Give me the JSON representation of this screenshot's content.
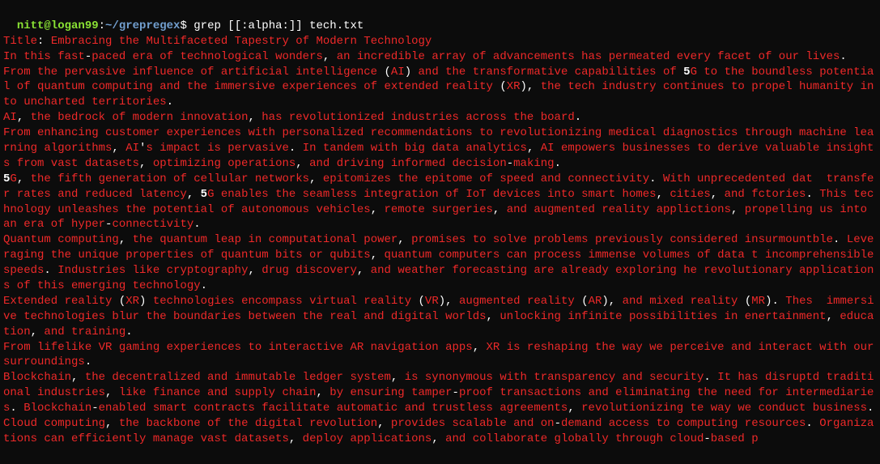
{
  "prompt": {
    "user": "nitt",
    "at": "@",
    "host": "logan99",
    "colon": ":",
    "path": "~/grepregex",
    "dollar": "$ ",
    "command": "grep [[:alpha:]] tech.txt"
  },
  "lines": [
    {
      "parts": [
        {
          "t": "Title",
          "c": "red"
        },
        {
          "t": ": ",
          "c": "white"
        },
        {
          "t": "Embracing the Multifaceted Tapestry of Modern Technology",
          "c": "red"
        }
      ]
    },
    {
      "parts": [
        {
          "t": "In this fast",
          "c": "red"
        },
        {
          "t": "-",
          "c": "white"
        },
        {
          "t": "paced era of technological wonders",
          "c": "red"
        },
        {
          "t": ", ",
          "c": "white"
        },
        {
          "t": "an incredible array of advancements has permeated every facet of our lives",
          "c": "red"
        },
        {
          "t": ".",
          "c": "white"
        }
      ]
    },
    {
      "parts": [
        {
          "t": "From the pervasive influence of artificial intelligence ",
          "c": "red"
        },
        {
          "t": "(",
          "c": "white"
        },
        {
          "t": "AI",
          "c": "red"
        },
        {
          "t": ") ",
          "c": "white"
        },
        {
          "t": "and the transformative capabilities of ",
          "c": "red"
        },
        {
          "t": "5",
          "c": "bold"
        },
        {
          "t": "G to the boundless potential of quantum computing and the immersive experiences of extended reality ",
          "c": "red"
        },
        {
          "t": "(",
          "c": "white"
        },
        {
          "t": "XR",
          "c": "red"
        },
        {
          "t": "), ",
          "c": "white"
        },
        {
          "t": "the tech industry continues to propel humanity into uncharted territories",
          "c": "red"
        },
        {
          "t": ".",
          "c": "white"
        }
      ]
    },
    {
      "parts": [
        {
          "t": "AI",
          "c": "red"
        },
        {
          "t": ", ",
          "c": "white"
        },
        {
          "t": "the bedrock of modern innovation",
          "c": "red"
        },
        {
          "t": ", ",
          "c": "white"
        },
        {
          "t": "has revolutionized industries across the board",
          "c": "red"
        },
        {
          "t": ".",
          "c": "white"
        }
      ]
    },
    {
      "parts": [
        {
          "t": "From enhancing customer experiences with personalized recommendations to revolutionizing medical diagnostics through machine learning algorithms",
          "c": "red"
        },
        {
          "t": ", ",
          "c": "white"
        },
        {
          "t": "AI",
          "c": "red"
        },
        {
          "t": "'",
          "c": "white"
        },
        {
          "t": "s impact is pervasive",
          "c": "red"
        },
        {
          "t": ". ",
          "c": "white"
        },
        {
          "t": "In tandem with big data analytics",
          "c": "red"
        },
        {
          "t": ", ",
          "c": "white"
        },
        {
          "t": "AI empowers businesses to derive valuable insights from vast datasets",
          "c": "red"
        },
        {
          "t": ", ",
          "c": "white"
        },
        {
          "t": "optimizing operations",
          "c": "red"
        },
        {
          "t": ", ",
          "c": "white"
        },
        {
          "t": "and driving informed decision",
          "c": "red"
        },
        {
          "t": "-",
          "c": "white"
        },
        {
          "t": "making",
          "c": "red"
        },
        {
          "t": ".",
          "c": "white"
        }
      ]
    },
    {
      "parts": [
        {
          "t": "5",
          "c": "bold"
        },
        {
          "t": "G",
          "c": "red"
        },
        {
          "t": ", ",
          "c": "white"
        },
        {
          "t": "the fifth generation of cellular networks",
          "c": "red"
        },
        {
          "t": ", ",
          "c": "white"
        },
        {
          "t": "epitomizes the epitome of speed and connectivity",
          "c": "red"
        },
        {
          "t": ". ",
          "c": "white"
        },
        {
          "t": "With unprecedented dat  transfer rates and reduced latency",
          "c": "red"
        },
        {
          "t": ", ",
          "c": "white"
        },
        {
          "t": "5",
          "c": "bold"
        },
        {
          "t": "G enables the seamless integration of IoT devices into smart homes",
          "c": "red"
        },
        {
          "t": ", ",
          "c": "white"
        },
        {
          "t": "cities",
          "c": "red"
        },
        {
          "t": ", ",
          "c": "white"
        },
        {
          "t": "and fctories",
          "c": "red"
        },
        {
          "t": ". ",
          "c": "white"
        },
        {
          "t": "This technology unleashes the potential of autonomous vehicles",
          "c": "red"
        },
        {
          "t": ", ",
          "c": "white"
        },
        {
          "t": "remote surgeries",
          "c": "red"
        },
        {
          "t": ", ",
          "c": "white"
        },
        {
          "t": "and augmented reality applictions",
          "c": "red"
        },
        {
          "t": ", ",
          "c": "white"
        },
        {
          "t": "propelling us into an era of hyper",
          "c": "red"
        },
        {
          "t": "-",
          "c": "white"
        },
        {
          "t": "connectivity",
          "c": "red"
        },
        {
          "t": ".",
          "c": "white"
        }
      ]
    },
    {
      "parts": [
        {
          "t": "Quantum computing",
          "c": "red"
        },
        {
          "t": ", ",
          "c": "white"
        },
        {
          "t": "the quantum leap in computational power",
          "c": "red"
        },
        {
          "t": ", ",
          "c": "white"
        },
        {
          "t": "promises to solve problems previously considered insurmountble",
          "c": "red"
        },
        {
          "t": ". ",
          "c": "white"
        },
        {
          "t": "Leveraging the unique properties of quantum bits or qubits",
          "c": "red"
        },
        {
          "t": ", ",
          "c": "white"
        },
        {
          "t": "quantum computers can process immense volumes of data t incomprehensible speeds",
          "c": "red"
        },
        {
          "t": ". ",
          "c": "white"
        },
        {
          "t": "Industries like cryptography",
          "c": "red"
        },
        {
          "t": ", ",
          "c": "white"
        },
        {
          "t": "drug discovery",
          "c": "red"
        },
        {
          "t": ", ",
          "c": "white"
        },
        {
          "t": "and weather forecasting are already exploring he revolutionary applications of this emerging technology",
          "c": "red"
        },
        {
          "t": ".",
          "c": "white"
        }
      ]
    },
    {
      "parts": [
        {
          "t": "Extended reality ",
          "c": "red"
        },
        {
          "t": "(",
          "c": "white"
        },
        {
          "t": "XR",
          "c": "red"
        },
        {
          "t": ") ",
          "c": "white"
        },
        {
          "t": "technologies encompass virtual reality ",
          "c": "red"
        },
        {
          "t": "(",
          "c": "white"
        },
        {
          "t": "VR",
          "c": "red"
        },
        {
          "t": "), ",
          "c": "white"
        },
        {
          "t": "augmented reality ",
          "c": "red"
        },
        {
          "t": "(",
          "c": "white"
        },
        {
          "t": "AR",
          "c": "red"
        },
        {
          "t": "), ",
          "c": "white"
        },
        {
          "t": "and mixed reality ",
          "c": "red"
        },
        {
          "t": "(",
          "c": "white"
        },
        {
          "t": "MR",
          "c": "red"
        },
        {
          "t": "). ",
          "c": "white"
        },
        {
          "t": "Thes  immersive technologies blur the boundaries between the real and digital worlds",
          "c": "red"
        },
        {
          "t": ", ",
          "c": "white"
        },
        {
          "t": "unlocking infinite possibilities in enertainment",
          "c": "red"
        },
        {
          "t": ", ",
          "c": "white"
        },
        {
          "t": "education",
          "c": "red"
        },
        {
          "t": ", ",
          "c": "white"
        },
        {
          "t": "and training",
          "c": "red"
        },
        {
          "t": ".",
          "c": "white"
        }
      ]
    },
    {
      "parts": [
        {
          "t": "From lifelike VR gaming experiences to interactive AR navigation apps",
          "c": "red"
        },
        {
          "t": ", ",
          "c": "white"
        },
        {
          "t": "XR is reshaping the way we perceive and interact with our surroundings",
          "c": "red"
        },
        {
          "t": ".",
          "c": "white"
        }
      ]
    },
    {
      "parts": [
        {
          "t": "Blockchain",
          "c": "red"
        },
        {
          "t": ", ",
          "c": "white"
        },
        {
          "t": "the decentralized and immutable ledger system",
          "c": "red"
        },
        {
          "t": ", ",
          "c": "white"
        },
        {
          "t": "is synonymous with transparency and security",
          "c": "red"
        },
        {
          "t": ". ",
          "c": "white"
        },
        {
          "t": "It has disruptd traditional industries",
          "c": "red"
        },
        {
          "t": ", ",
          "c": "white"
        },
        {
          "t": "like finance and supply chain",
          "c": "red"
        },
        {
          "t": ", ",
          "c": "white"
        },
        {
          "t": "by ensuring tamper",
          "c": "red"
        },
        {
          "t": "-",
          "c": "white"
        },
        {
          "t": "proof transactions and eliminating the need for intermediaries",
          "c": "red"
        },
        {
          "t": ". ",
          "c": "white"
        },
        {
          "t": "Blockchain",
          "c": "red"
        },
        {
          "t": "-",
          "c": "white"
        },
        {
          "t": "enabled smart contracts facilitate automatic and trustless agreements",
          "c": "red"
        },
        {
          "t": ", ",
          "c": "white"
        },
        {
          "t": "revolutionizing te way we conduct business",
          "c": "red"
        },
        {
          "t": ".",
          "c": "white"
        }
      ]
    },
    {
      "parts": [
        {
          "t": "Cloud computing",
          "c": "red"
        },
        {
          "t": ", ",
          "c": "white"
        },
        {
          "t": "the backbone of the digital revolution",
          "c": "red"
        },
        {
          "t": ", ",
          "c": "white"
        },
        {
          "t": "provides scalable and on",
          "c": "red"
        },
        {
          "t": "-",
          "c": "white"
        },
        {
          "t": "demand access to computing resources",
          "c": "red"
        },
        {
          "t": ". ",
          "c": "white"
        },
        {
          "t": "Organizations can efficiently manage vast datasets",
          "c": "red"
        },
        {
          "t": ", ",
          "c": "white"
        },
        {
          "t": "deploy applications",
          "c": "red"
        },
        {
          "t": ", ",
          "c": "white"
        },
        {
          "t": "and collaborate globally through cloud",
          "c": "red"
        },
        {
          "t": "-",
          "c": "white"
        },
        {
          "t": "based p",
          "c": "red"
        }
      ]
    }
  ]
}
